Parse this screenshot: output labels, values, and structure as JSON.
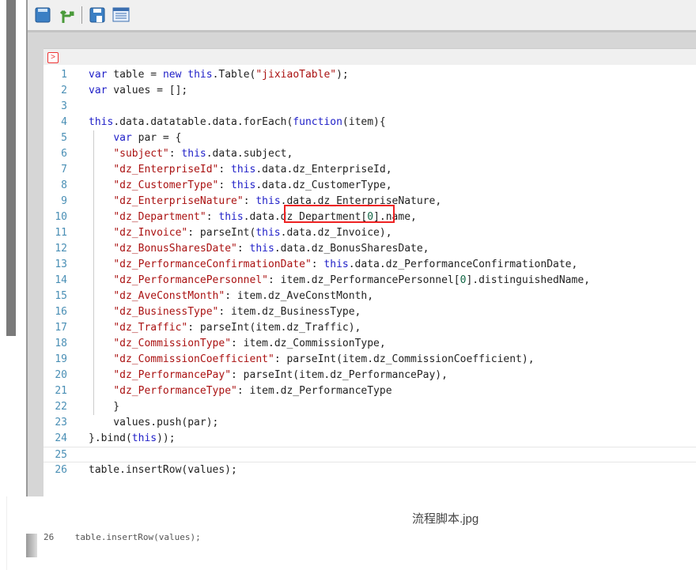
{
  "toolbar": {
    "buttons": [
      {
        "name": "save-icon"
      },
      {
        "name": "branch-icon"
      },
      {
        "name": "save-as-icon"
      },
      {
        "name": "list-icon"
      }
    ]
  },
  "editor": {
    "run_icon": "run-icon",
    "highlighted": "dz_Department[0]",
    "active_line": 25,
    "lines": [
      [
        [
          "k",
          "var"
        ],
        [
          "t",
          " table = "
        ],
        [
          "k",
          "new"
        ],
        [
          "t",
          " "
        ],
        [
          "k",
          "this"
        ],
        [
          "t",
          ".Table("
        ],
        [
          "s",
          "\"jixiaoTable\""
        ],
        [
          "t",
          ");"
        ]
      ],
      [
        [
          "k",
          "var"
        ],
        [
          "t",
          " values = [];"
        ]
      ],
      [],
      [
        [
          "k",
          "this"
        ],
        [
          "t",
          ".data.datatable.data.forEach("
        ],
        [
          "k",
          "function"
        ],
        [
          "t",
          "(item){"
        ]
      ],
      [
        [
          "t",
          "    "
        ],
        [
          "k",
          "var"
        ],
        [
          "t",
          " par = {"
        ]
      ],
      [
        [
          "t",
          "    "
        ],
        [
          "s",
          "\"subject\""
        ],
        [
          "t",
          ": "
        ],
        [
          "k",
          "this"
        ],
        [
          "t",
          ".data.subject,"
        ]
      ],
      [
        [
          "t",
          "    "
        ],
        [
          "s",
          "\"dz_EnterpriseId\""
        ],
        [
          "t",
          ": "
        ],
        [
          "k",
          "this"
        ],
        [
          "t",
          ".data.dz_EnterpriseId,"
        ]
      ],
      [
        [
          "t",
          "    "
        ],
        [
          "s",
          "\"dz_CustomerType\""
        ],
        [
          "t",
          ": "
        ],
        [
          "k",
          "this"
        ],
        [
          "t",
          ".data.dz_CustomerType,"
        ]
      ],
      [
        [
          "t",
          "    "
        ],
        [
          "s",
          "\"dz_EnterpriseNature\""
        ],
        [
          "t",
          ": "
        ],
        [
          "k",
          "this"
        ],
        [
          "t",
          ".data.dz_EnterpriseNature,"
        ]
      ],
      [
        [
          "t",
          "    "
        ],
        [
          "s",
          "\"dz_Department\""
        ],
        [
          "t",
          ": "
        ],
        [
          "k",
          "this"
        ],
        [
          "t",
          ".data.dz_Department["
        ],
        [
          "n",
          "0"
        ],
        [
          "t",
          "].name,"
        ]
      ],
      [
        [
          "t",
          "    "
        ],
        [
          "s",
          "\"dz_Invoice\""
        ],
        [
          "t",
          ": parseInt("
        ],
        [
          "k",
          "this"
        ],
        [
          "t",
          ".data.dz_Invoice),"
        ]
      ],
      [
        [
          "t",
          "    "
        ],
        [
          "s",
          "\"dz_BonusSharesDate\""
        ],
        [
          "t",
          ": "
        ],
        [
          "k",
          "this"
        ],
        [
          "t",
          ".data.dz_BonusSharesDate,"
        ]
      ],
      [
        [
          "t",
          "    "
        ],
        [
          "s",
          "\"dz_PerformanceConfirmationDate\""
        ],
        [
          "t",
          ": "
        ],
        [
          "k",
          "this"
        ],
        [
          "t",
          ".data.dz_PerformanceConfirmationDate,"
        ]
      ],
      [
        [
          "t",
          "    "
        ],
        [
          "s",
          "\"dz_PerformancePersonnel\""
        ],
        [
          "t",
          ": item.dz_PerformancePersonnel["
        ],
        [
          "n",
          "0"
        ],
        [
          "t",
          "].distinguishedName,"
        ]
      ],
      [
        [
          "t",
          "    "
        ],
        [
          "s",
          "\"dz_AveConstMonth\""
        ],
        [
          "t",
          ": item.dz_AveConstMonth,"
        ]
      ],
      [
        [
          "t",
          "    "
        ],
        [
          "s",
          "\"dz_BusinessType\""
        ],
        [
          "t",
          ": item.dz_BusinessType,"
        ]
      ],
      [
        [
          "t",
          "    "
        ],
        [
          "s",
          "\"dz_Traffic\""
        ],
        [
          "t",
          ": parseInt(item.dz_Traffic),"
        ]
      ],
      [
        [
          "t",
          "    "
        ],
        [
          "s",
          "\"dz_CommissionType\""
        ],
        [
          "t",
          ": item.dz_CommissionType,"
        ]
      ],
      [
        [
          "t",
          "    "
        ],
        [
          "s",
          "\"dz_CommissionCoefficient\""
        ],
        [
          "t",
          ": parseInt(item.dz_CommissionCoefficient),"
        ]
      ],
      [
        [
          "t",
          "    "
        ],
        [
          "s",
          "\"dz_PerformancePay\""
        ],
        [
          "t",
          ": parseInt(item.dz_PerformancePay),"
        ]
      ],
      [
        [
          "t",
          "    "
        ],
        [
          "s",
          "\"dz_PerformanceType\""
        ],
        [
          "t",
          ": item.dz_PerformanceType"
        ]
      ],
      [
        [
          "t",
          "    }"
        ]
      ],
      [
        [
          "t",
          "    values.push(par);"
        ]
      ],
      [
        [
          "t",
          "}.bind("
        ],
        [
          "k",
          "this"
        ],
        [
          "t",
          "));"
        ]
      ],
      [],
      [
        [
          "t",
          "table.insertRow(values);"
        ]
      ]
    ]
  },
  "caption": "流程脚本.jpg",
  "fragment": {
    "line_number": "26",
    "text": "table.insertRow(values);"
  }
}
